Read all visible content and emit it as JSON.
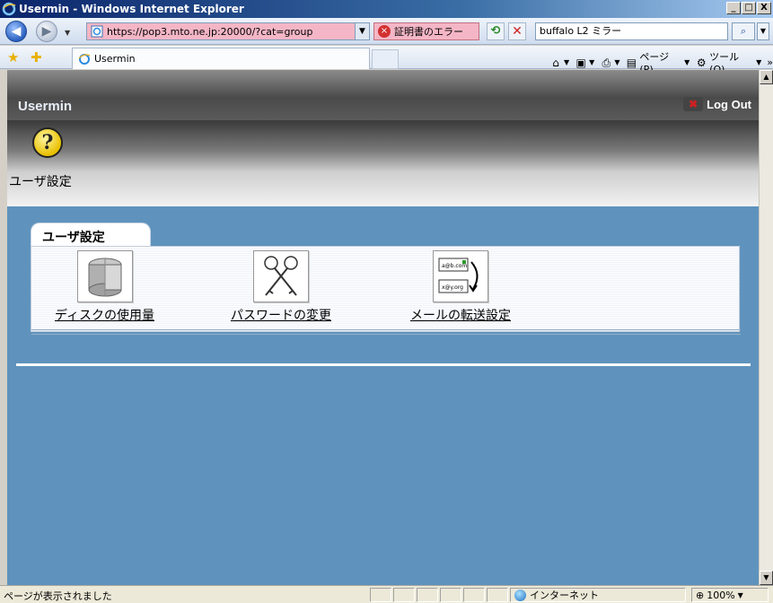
{
  "window": {
    "title": "Usermin - Windows Internet Explorer",
    "controls": {
      "minimize": "_",
      "maximize": "□",
      "close": "X"
    }
  },
  "addressbar": {
    "url": "https://pop3.mto.ne.jp:20000/?cat=group",
    "cert_error": "証明書のエラー",
    "search_value": "buffalo L2 ミラー"
  },
  "tabs": {
    "active_label": "Usermin"
  },
  "commandbar": {
    "page_label": "ページ(P)",
    "tools_label": "ツール(O)"
  },
  "usermin": {
    "brand": "Usermin",
    "logout": "Log Out",
    "banner_label": "ユーザ設定",
    "category_tab": "ユーザ設定",
    "modules": [
      {
        "label": "ディスクの使用量",
        "icon": "disk-usage-icon"
      },
      {
        "label": "パスワードの変更",
        "icon": "keys-icon"
      },
      {
        "label": "メールの転送設定",
        "icon": "mail-forward-icon"
      }
    ],
    "mail_icon_text": {
      "line1": "a@b.com",
      "line2": "x@y.org"
    }
  },
  "status": {
    "text": "ページが表示されました",
    "zone": "インターネット",
    "zoom": "100%"
  },
  "colors": {
    "content_bg": "#5f93bd",
    "url_error_bg": "#f4b6c6"
  }
}
